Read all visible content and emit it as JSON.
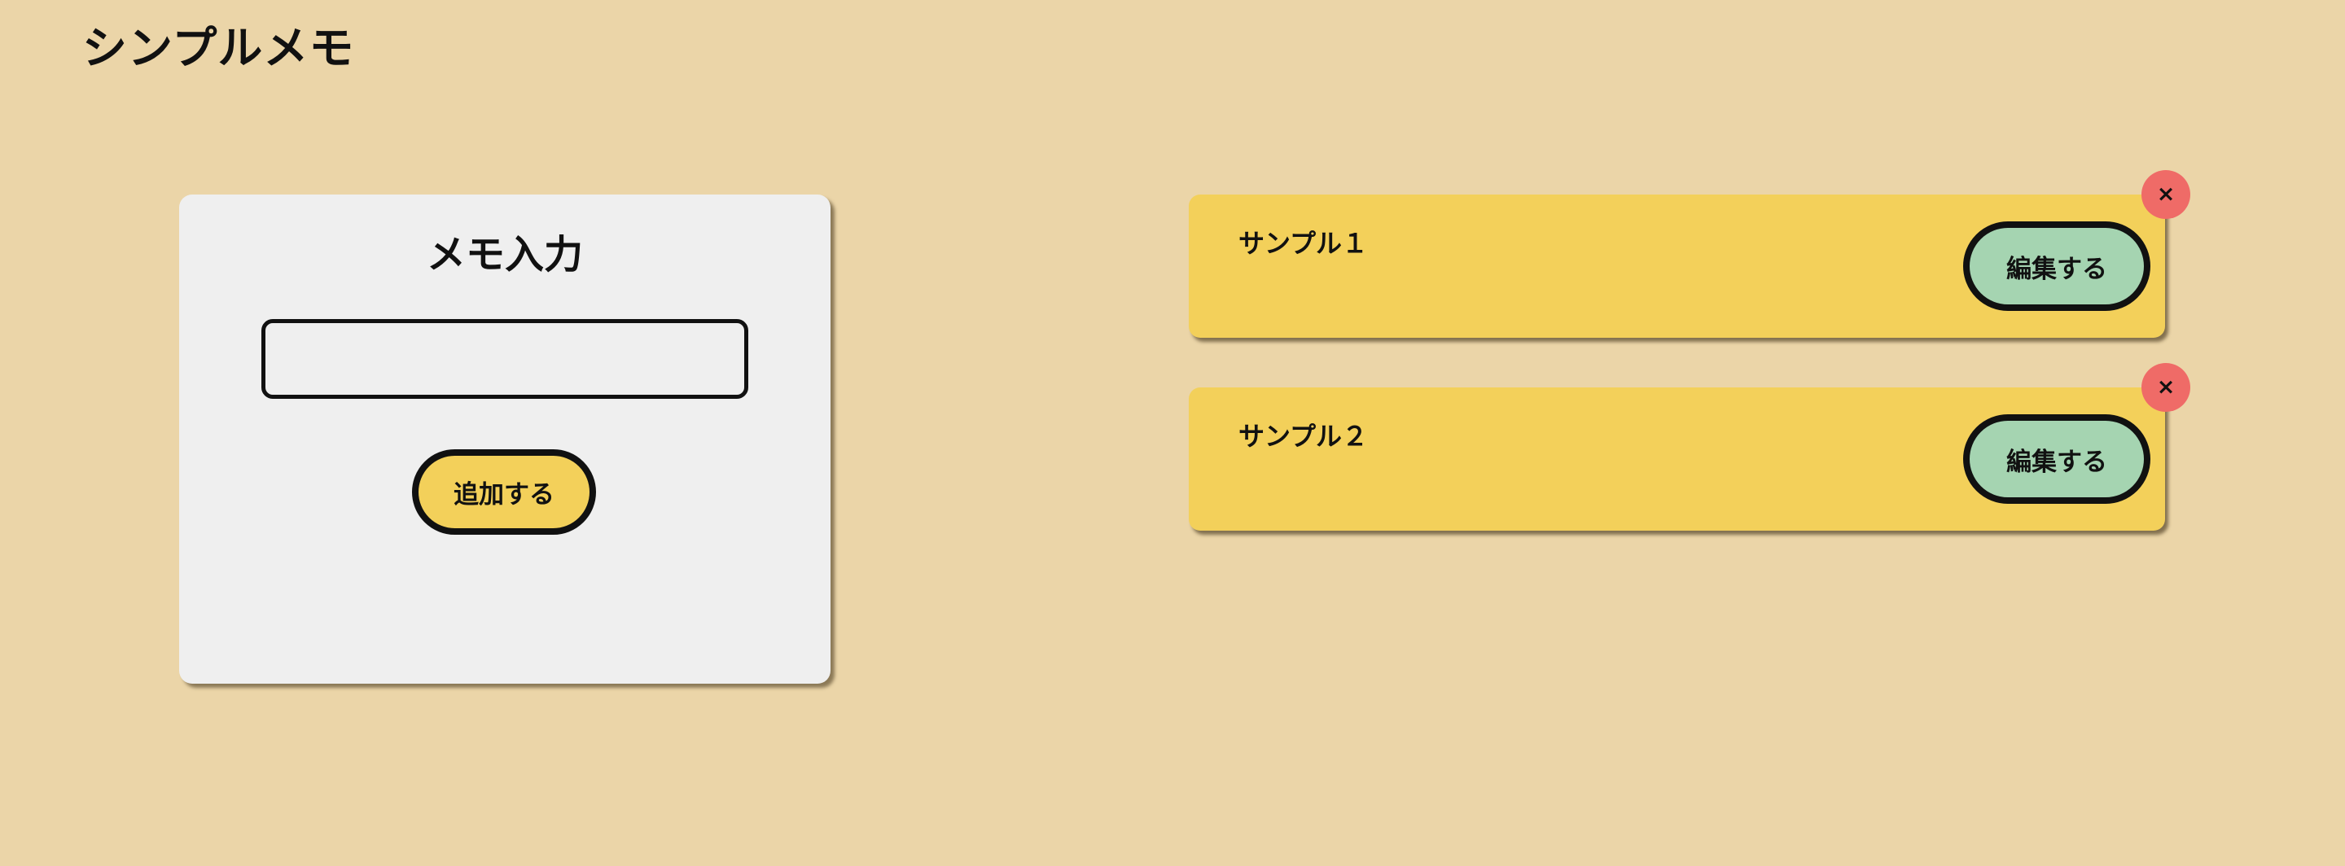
{
  "app": {
    "title": "シンプルメモ"
  },
  "input_panel": {
    "title": "メモ入力",
    "memo_input": {
      "value": "",
      "placeholder": ""
    },
    "add_button_label": "追加する"
  },
  "memos": [
    {
      "text": "サンプル１",
      "edit_label": "編集する",
      "delete_label": "×",
      "delete_icon": "close-icon"
    },
    {
      "text": "サンプル２",
      "edit_label": "編集する",
      "delete_label": "×",
      "delete_icon": "close-icon"
    }
  ],
  "colors": {
    "background": "#ebd5a8",
    "panel": "#efefef",
    "memo_card": "#f3d05a",
    "add_button": "#f3d05a",
    "edit_button": "#a5d4b1",
    "delete_button": "#ef6b67"
  }
}
